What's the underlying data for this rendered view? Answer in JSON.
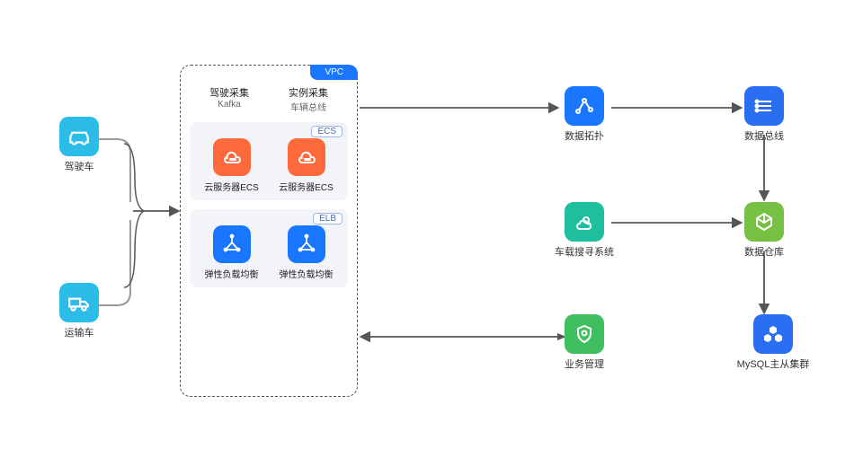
{
  "left": {
    "car": {
      "label": "驾驶车"
    },
    "truck": {
      "label": "运输车"
    }
  },
  "container": {
    "tab": "VPC",
    "header": {
      "left": {
        "title": "驾驶采集",
        "subtitle": "Kafka"
      },
      "right": {
        "title": "实例采集",
        "subtitle": "车辆总线"
      }
    },
    "ecs": {
      "tag": "ECS",
      "items": [
        {
          "label": "云服务器ECS"
        },
        {
          "label": "云服务器ECS"
        }
      ]
    },
    "elb": {
      "tag": "ELB",
      "items": [
        {
          "label": "弹性负载均衡"
        },
        {
          "label": "弹性负载均衡"
        }
      ]
    }
  },
  "right": {
    "topo": {
      "label": "数据拓扑"
    },
    "bus": {
      "label": "数据总线"
    },
    "search": {
      "label": "车载搜寻系统"
    },
    "warehouse": {
      "label": "数据仓库"
    },
    "mgmt": {
      "label": "业务管理"
    },
    "mysql": {
      "label": "MySQL主从集群"
    }
  }
}
